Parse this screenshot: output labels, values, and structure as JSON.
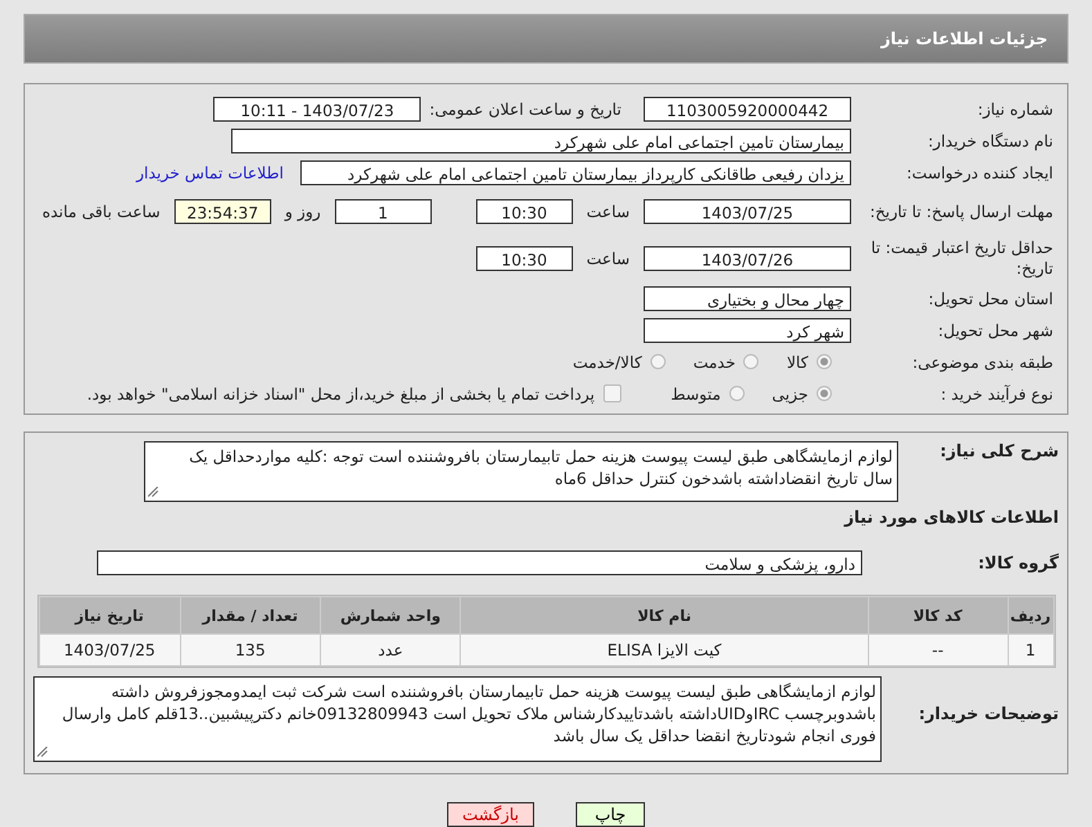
{
  "header": {
    "title": "جزئیات اطلاعات نیاز"
  },
  "need_number": {
    "label": "شماره نیاز:",
    "value": "1103005920000442"
  },
  "announce": {
    "label": "تاریخ و ساعت اعلان عمومی:",
    "value": "1403/07/23 - 10:11"
  },
  "buyer_org": {
    "label": "نام دستگاه خریدار:",
    "value": "بیمارستان تامین اجتماعی امام علی شهرکرد"
  },
  "requester": {
    "label": "ایجاد کننده درخواست:",
    "value": "یزدان رفیعی طاقانکی کارپرداز بیمارستان تامین اجتماعی امام علی شهرکرد",
    "link": "اطلاعات تماس خریدار"
  },
  "response_deadline": {
    "label": "مهلت ارسال پاسخ: تا تاریخ:",
    "date": "1403/07/25",
    "time_label": "ساعت",
    "time": "10:30",
    "days": "1",
    "days_label": "روز و",
    "remaining": "23:54:37",
    "remaining_label": "ساعت باقی مانده"
  },
  "price_validity": {
    "label": "حداقل تاریخ اعتبار قیمت: تا تاریخ:",
    "date": "1403/07/26",
    "time_label": "ساعت",
    "time": "10:30"
  },
  "province": {
    "label": "استان محل تحویل:",
    "value": "چهار محال و بختیاری"
  },
  "city": {
    "label": "شهر محل تحویل:",
    "value": "شهر کرد"
  },
  "category": {
    "label": "طبقه بندی موضوعی:",
    "options": [
      {
        "label": "کالا",
        "selected": true
      },
      {
        "label": "خدمت",
        "selected": false
      },
      {
        "label": "کالا/خدمت",
        "selected": false
      }
    ]
  },
  "process": {
    "label": "نوع فرآیند خرید :",
    "options": [
      {
        "label": "جزیی",
        "selected": true
      },
      {
        "label": "متوسط",
        "selected": false
      }
    ],
    "payment": {
      "label": "پرداخت تمام یا بخشی از مبلغ خرید،از محل \"اسناد خزانه اسلامی\" خواهد بود.",
      "checked": false
    }
  },
  "summary": {
    "label": "شرح کلی نیاز:",
    "value": "لوازم ازمایشگاهی طبق لیست پیوست هزینه حمل تابیمارستان بافروشننده است توجه :کلیه مواردحداقل یک سال تاریخ انقضاداشته باشدخون کنترل حداقل 6ماه"
  },
  "goods_title": "اطلاعات کالاهای مورد نیاز",
  "goods_group": {
    "label": "گروه کالا:",
    "value": "دارو، پزشکی و سلامت"
  },
  "table": {
    "columns": [
      "ردیف",
      "کد کالا",
      "نام کالا",
      "واحد شمارش",
      "تعداد / مقدار",
      "تاریخ نیاز"
    ],
    "rows": [
      [
        "1",
        "--",
        "کیت الایزا ELISA",
        "عدد",
        "135",
        "1403/07/25"
      ]
    ]
  },
  "buyer_notes": {
    "label": "توضیحات خریدار:",
    "value": "لوازم ازمایشگاهی طبق لیست پیوست هزینه حمل تابیمارستان بافروشننده است شرکت ثبت ایمدومجوزفروش داشته باشدوبرچسب IRCوUIDداشته باشدتاییدکارشناس ملاک تحویل است 09132809943خانم دکترپیشبین..13قلم کامل وارسال فوری انجام شودتاریخ انقضا حداقل یک سال باشد"
  },
  "buttons": [
    {
      "label": "چاپ",
      "kind": "print"
    },
    {
      "label": "بازگشت",
      "kind": "back"
    }
  ]
}
